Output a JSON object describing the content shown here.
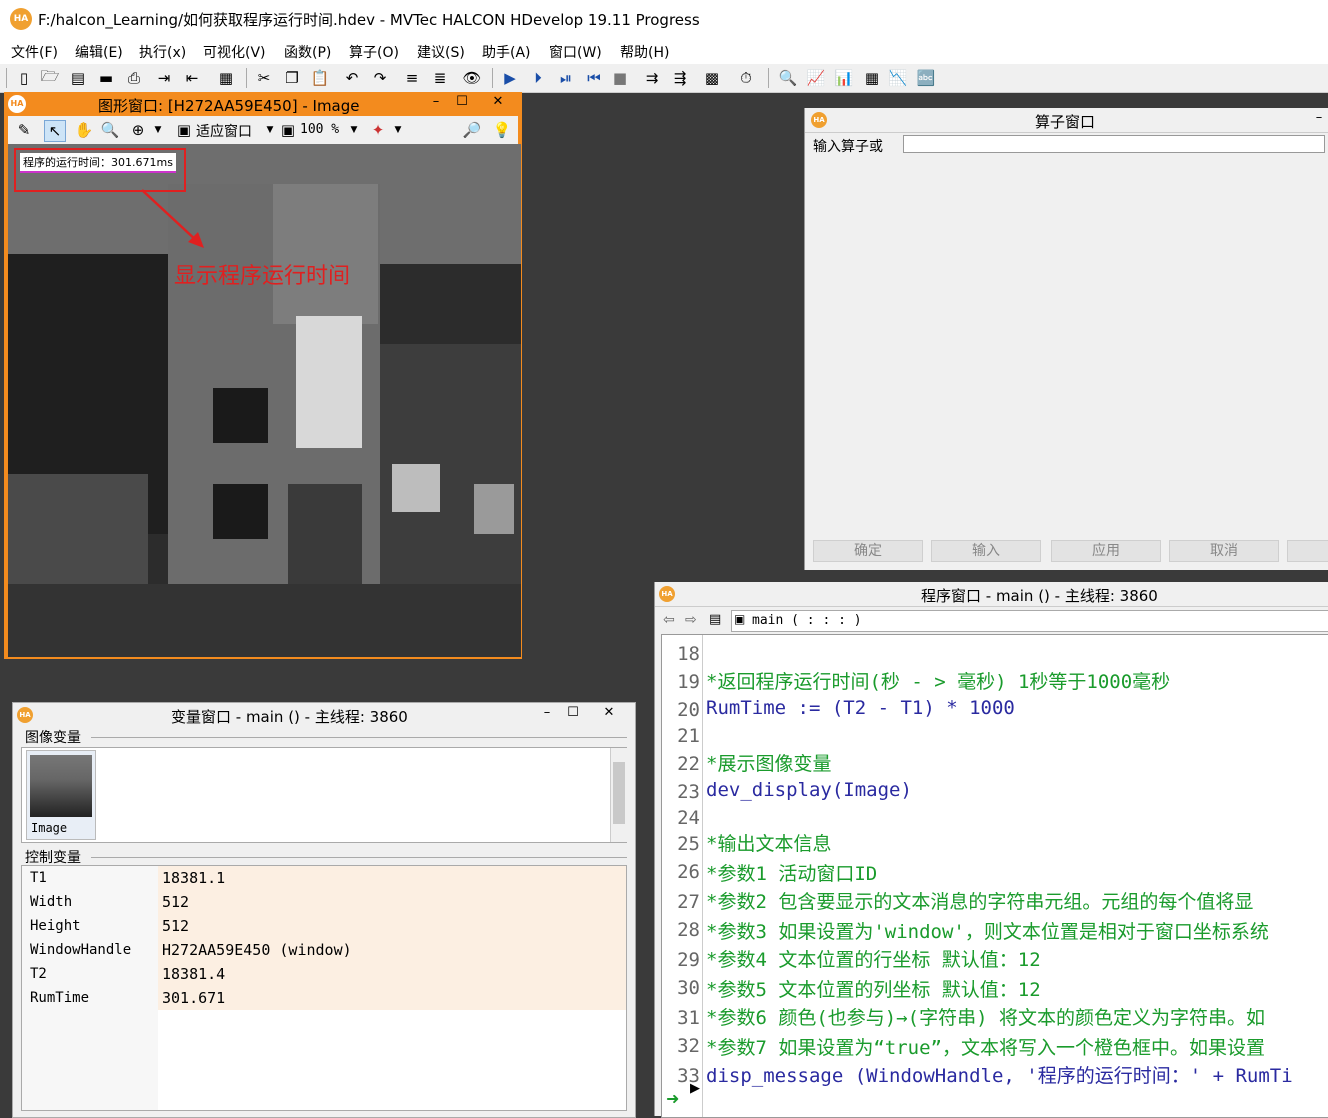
{
  "app": {
    "title": "F:/halcon_Learning/如何获取程序运行时间.hdev - MVTec HALCON HDevelop 19.11 Progress",
    "logo_text": "HA"
  },
  "menu": [
    "文件(F)",
    "编辑(E)",
    "执行(x)",
    "可视化(V)",
    "函数(P)",
    "算子(O)",
    "建议(S)",
    "助手(A)",
    "窗口(W)",
    "帮助(H)"
  ],
  "graphics_window": {
    "title": "图形窗口: [H272AA59E450] - Image",
    "fit_label": "适应窗口",
    "zoom_label": "100 %",
    "message_box": "程序的运行时间：301.671ms",
    "annotation": "显示程序运行时间"
  },
  "operator_window": {
    "title": "算子窗口",
    "input_label": "输入算子或",
    "input_value": "",
    "buttons": [
      "确定",
      "输入",
      "应用",
      "取消"
    ]
  },
  "program_window": {
    "title": "程序窗口 - main () - 主线程: 3860",
    "proc_name": "main ( : : : )",
    "lines": [
      {
        "no": "18",
        "text": "",
        "cls": ""
      },
      {
        "no": "19",
        "text": "*返回程序运行时间(秒 - > 毫秒)    1秒等于1000毫秒",
        "cls": "cmt"
      },
      {
        "no": "20",
        "text": "RumTime := (T2 - T1) * 1000",
        "cls": "op"
      },
      {
        "no": "21",
        "text": "",
        "cls": ""
      },
      {
        "no": "22",
        "text": "*展示图像变量",
        "cls": "cmt"
      },
      {
        "no": "23",
        "text": "dev_display(Image)",
        "cls": "op"
      },
      {
        "no": "24",
        "text": "",
        "cls": ""
      },
      {
        "no": "25",
        "text": "*输出文本信息",
        "cls": "cmt"
      },
      {
        "no": "26",
        "text": "*参数1 活动窗口ID",
        "cls": "cmt"
      },
      {
        "no": "27",
        "text": "*参数2 包含要显示的文本消息的字符串元组。元组的每个值将显",
        "cls": "cmt"
      },
      {
        "no": "28",
        "text": "*参数3 如果设置为'window'，则文本位置是相对于窗口坐标系统",
        "cls": "cmt"
      },
      {
        "no": "29",
        "text": "*参数4 文本位置的行坐标 默认值：12",
        "cls": "cmt"
      },
      {
        "no": "30",
        "text": "*参数5 文本位置的列坐标 默认值：12",
        "cls": "cmt"
      },
      {
        "no": "31",
        "text": "*参数6 颜色(也参与)→(字符串) 将文本的颜色定义为字符串。如",
        "cls": "cmt"
      },
      {
        "no": "32",
        "text": "*参数7 如果设置为“true”，文本将写入一个橙色框中。如果设置",
        "cls": "cmt"
      },
      {
        "no": "33",
        "text": "disp_message (WindowHandle, '程序的运行时间：' + RumTi",
        "cls": "op"
      }
    ]
  },
  "variable_window": {
    "title": "变量窗口 - main () - 主线程: 3860",
    "iconic_header": "图像变量",
    "iconic_item": "Image",
    "control_header": "控制变量",
    "control_vars": [
      {
        "name": "T1",
        "value": "18381.1"
      },
      {
        "name": "Width",
        "value": "512"
      },
      {
        "name": "Height",
        "value": "512"
      },
      {
        "name": "WindowHandle",
        "value": "H272AA59E450 (window)"
      },
      {
        "name": "T2",
        "value": "18381.4"
      },
      {
        "name": "RumTime",
        "value": "301.671"
      }
    ]
  },
  "colors": {
    "orange": "#f38b1e",
    "comment_green": "#1a9b2c",
    "code_blue": "#2a2aa0",
    "annotation_red": "#e02020"
  }
}
